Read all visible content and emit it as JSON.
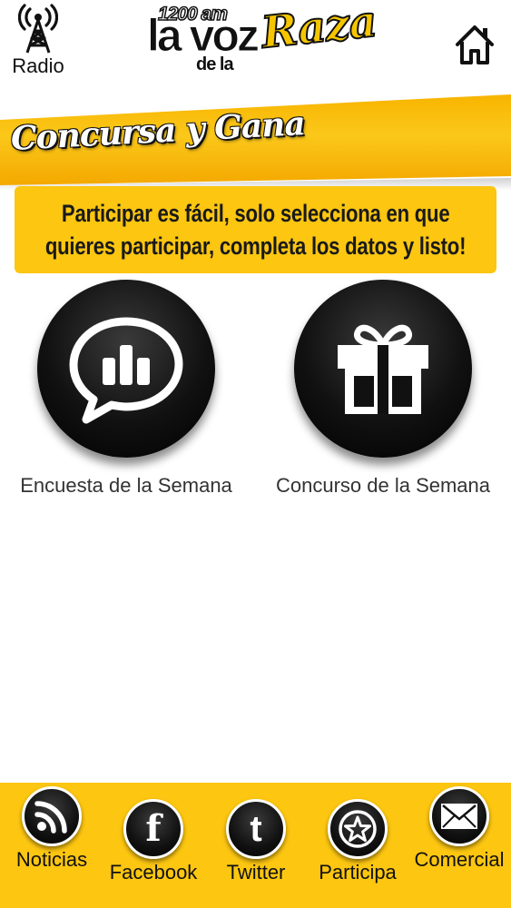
{
  "header": {
    "radio_label": "Radio",
    "logo": {
      "frequency": "1200 am",
      "main": "la voz",
      "connector": "de la",
      "script": "Raza"
    }
  },
  "banner": {
    "title": "Concursa y Gana",
    "line1": "Participar es fácil, solo selecciona en que",
    "line2": "quieres participar, completa los datos y listo!"
  },
  "options": [
    {
      "label": "Encuesta de la Semana",
      "icon": "poll-chat-icon"
    },
    {
      "label": "Concurso de la Semana",
      "icon": "gift-icon"
    }
  ],
  "bottom_nav": {
    "items": [
      {
        "label": "Noticias",
        "icon": "rss-icon"
      },
      {
        "label": "Facebook",
        "icon": "facebook-icon",
        "glyph": "f"
      },
      {
        "label": "Twitter",
        "icon": "twitter-icon",
        "glyph": "t"
      },
      {
        "label": "Participa",
        "icon": "star-icon"
      },
      {
        "label": "Comercial",
        "icon": "envelope-icon"
      }
    ]
  },
  "colors": {
    "brand_yellow": "#fcc611",
    "banner_orange": "#f8b400",
    "dark": "#111111"
  }
}
